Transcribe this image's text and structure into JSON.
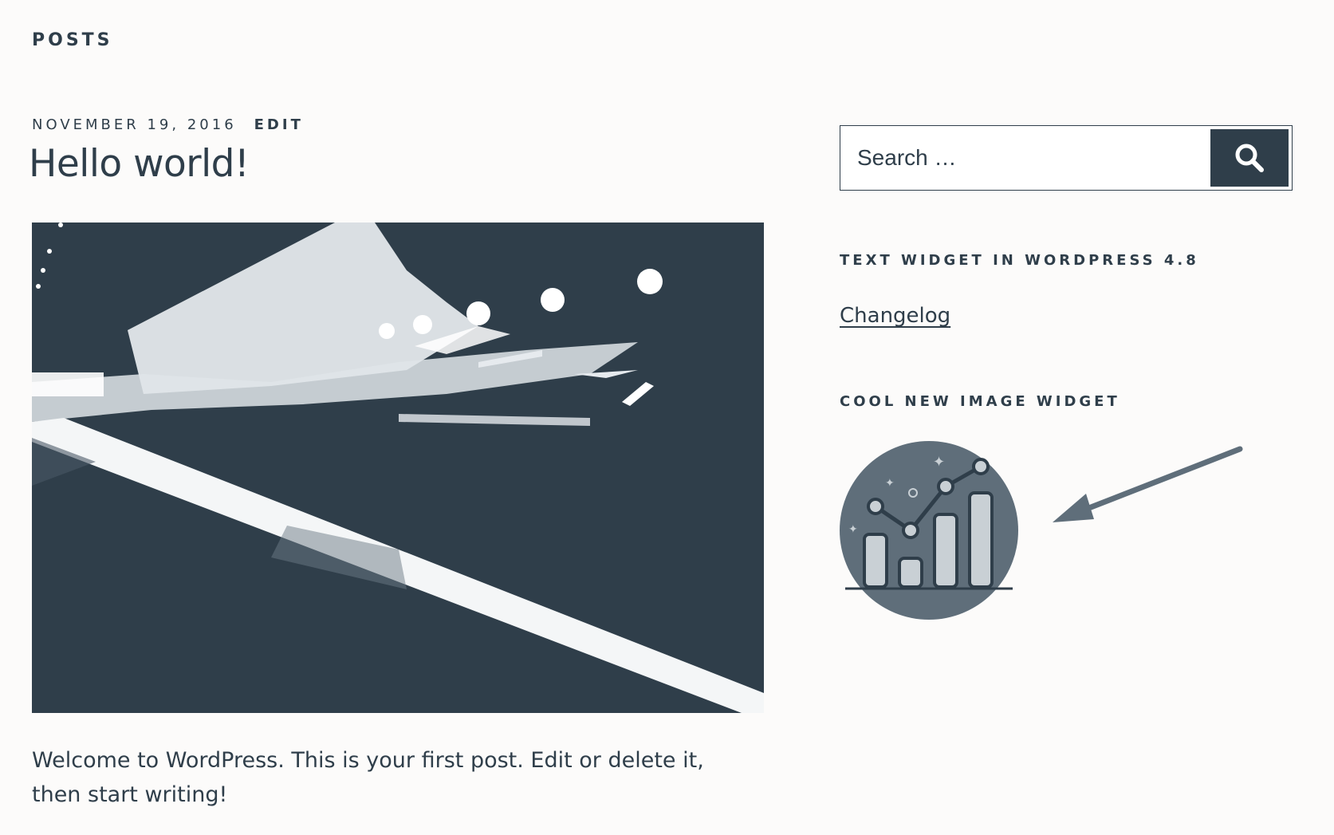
{
  "section": {
    "title": "POSTS"
  },
  "post": {
    "date": "NOVEMBER 19, 2016",
    "edit_label": "EDIT",
    "title": "Hello world!",
    "body": "Welcome to WordPress. This is your first post. Edit or delete it, then start writing!"
  },
  "sidebar": {
    "search": {
      "placeholder": "Search …"
    },
    "text_widget": {
      "title": "TEXT WIDGET IN WORDPRESS 4.8",
      "link_label": "Changelog"
    },
    "image_widget": {
      "title": "COOL NEW IMAGE WIDGET"
    }
  },
  "colors": {
    "primary": "#2f3e4a",
    "background": "#fcfbfa"
  },
  "icons": {
    "search_button": "search-icon",
    "widget_image": "bar-chart-icon",
    "annotation": "arrow-icon"
  }
}
